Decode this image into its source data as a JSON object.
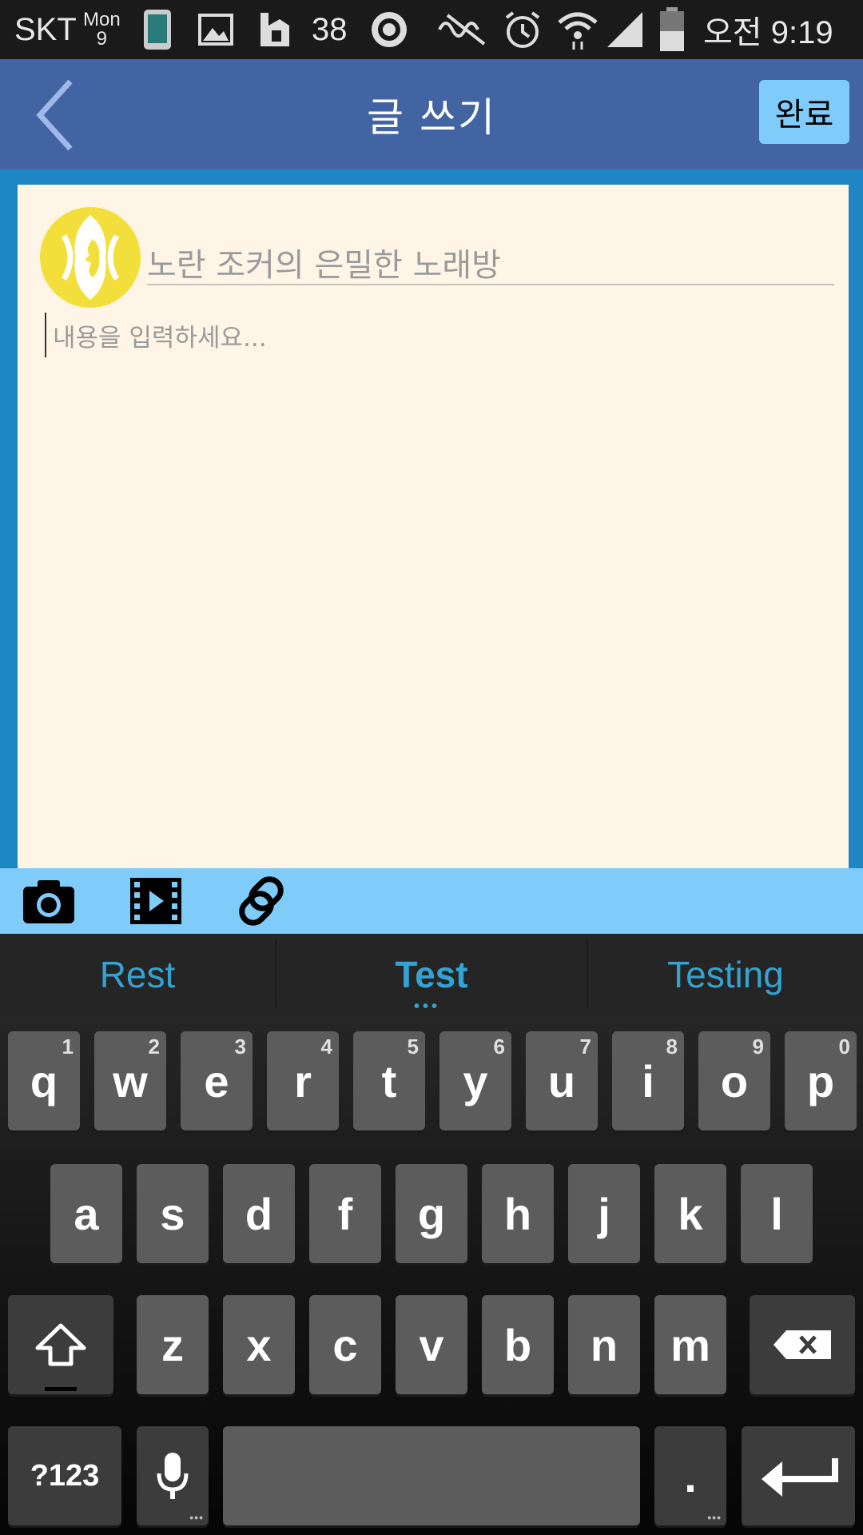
{
  "status_bar": {
    "carrier": "SKT",
    "day": "Mon",
    "date": "9",
    "notification_count": "38",
    "time": "오전 9:19",
    "icons": [
      "phone-icon",
      "gallery-icon",
      "app-icon",
      "circle-app-icon",
      "mute-icon",
      "alarm-icon",
      "wifi-icon",
      "signal-icon",
      "battery-icon"
    ]
  },
  "app_bar": {
    "title": "글 쓰기",
    "done_label": "완료",
    "back_icon": "back-chevron-icon"
  },
  "editor": {
    "board_name": "노란 조커의 은밀한 노래방",
    "content_placeholder": "내용을 입력하세요..."
  },
  "toolbar": {
    "tools": [
      "camera-icon",
      "video-icon",
      "link-icon"
    ]
  },
  "keyboard": {
    "suggestions": [
      "Rest",
      "Test",
      "Testing"
    ],
    "suggestion_more": "•••",
    "row1": [
      "q",
      "w",
      "e",
      "r",
      "t",
      "y",
      "u",
      "i",
      "o",
      "p"
    ],
    "row1_hints": [
      "1",
      "2",
      "3",
      "4",
      "5",
      "6",
      "7",
      "8",
      "9",
      "0"
    ],
    "row2": [
      "a",
      "s",
      "d",
      "f",
      "g",
      "h",
      "j",
      "k",
      "l"
    ],
    "row3": [
      "z",
      "x",
      "c",
      "v",
      "b",
      "n",
      "m"
    ],
    "symbols_label": "?123",
    "period_label": ".",
    "more_dots": "•••"
  },
  "colors": {
    "app_bar": "#4264a3",
    "accent": "#7fcbfa",
    "editor_bg": "#fef5e6",
    "page_bg": "#1f86c6",
    "suggestion_text": "#34a2d2"
  }
}
